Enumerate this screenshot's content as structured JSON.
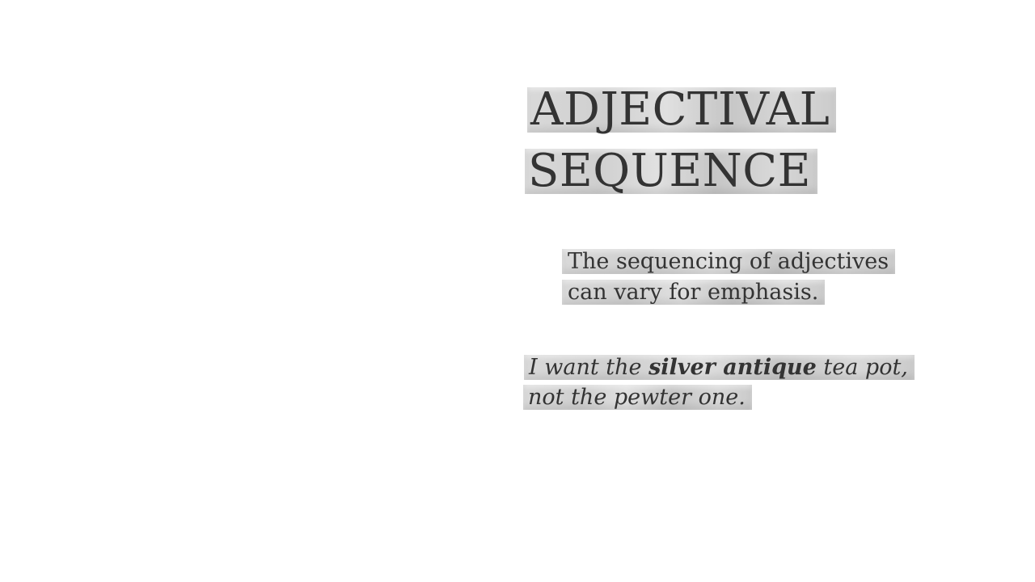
{
  "slide": {
    "title_lines": [
      "ADJECTIVAL",
      "SEQUENCE"
    ],
    "body_lines": [
      "The sequencing of adjectives",
      "can vary for emphasis."
    ],
    "example": {
      "line1_before": "I want the ",
      "line1_bold": "silver antique",
      "line1_after": " tea pot,",
      "line2": "not the pewter one."
    }
  }
}
